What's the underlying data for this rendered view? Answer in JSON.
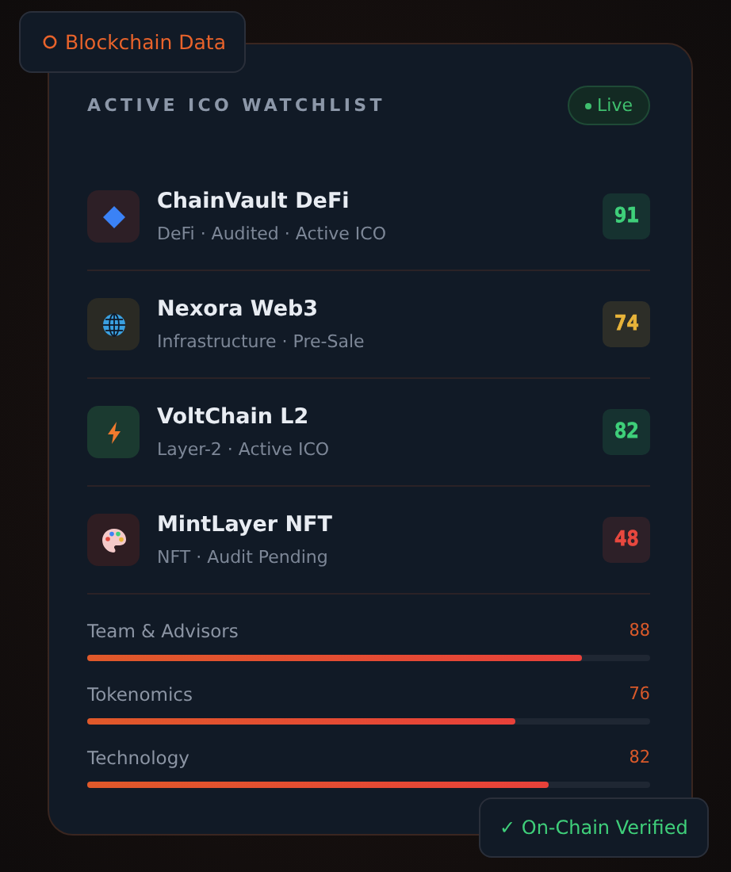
{
  "top_badge": {
    "label": "Blockchain Data"
  },
  "header": {
    "title": "ACTIVE ICO WATCHLIST",
    "status": "Live"
  },
  "projects": [
    {
      "name": "ChainVault DeFi",
      "meta": "DeFi · Audited · Active ICO",
      "kind": "diamond",
      "score": "91",
      "color": "#3fcf7a"
    },
    {
      "name": "Nexora Web3",
      "meta": "Infrastructure · Pre-Sale",
      "kind": "globe",
      "score": "74",
      "color": "#e8b43a"
    },
    {
      "name": "VoltChain L2",
      "meta": "Layer-2 · Active ICO",
      "kind": "bolt",
      "score": "82",
      "color": "#3fcf7a"
    },
    {
      "name": "MintLayer NFT",
      "meta": "NFT · Audit Pending",
      "kind": "palette",
      "score": "48",
      "color": "#e8483f"
    }
  ],
  "metrics": [
    {
      "label": "Team & Advisors",
      "value": "88",
      "level": 0.88
    },
    {
      "label": "Tokenomics",
      "value": "76",
      "level": 0.76
    },
    {
      "label": "Technology",
      "value": "82",
      "level": 0.82
    }
  ],
  "bottom_badge": {
    "label": "✓ On-Chain Verified"
  }
}
